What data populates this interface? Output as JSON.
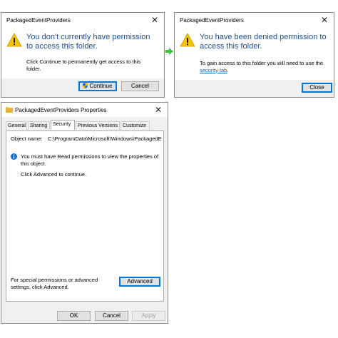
{
  "dialog1": {
    "title": "PackagedEventProviders",
    "message": "You don't currently have permission to access this folder.",
    "detail": "Click Continue to permanently get access to this folder.",
    "continue_label": "Continue",
    "cancel_label": "Cancel"
  },
  "dialog2": {
    "title": "PackagedEventProviders",
    "message": "You have been denied permission to access this folder.",
    "detail_prefix": "To gain access to this folder you will need to use the",
    "detail_link": "security tab",
    "detail_suffix": ".",
    "close_label": "Close"
  },
  "properties": {
    "title": "PackagedEventProviders Properties",
    "tabs": [
      "General",
      "Sharing",
      "Security",
      "Previous Versions",
      "Customize"
    ],
    "active_tab": "Security",
    "object_name_label": "Object name:",
    "object_name_value": "C:\\ProgramData\\Microsoft\\Windows\\PackagedEv",
    "info_text": "You must have Read permissions to view the properties of this object.",
    "advanced_hint": "Click Advanced to continue.",
    "special_text": "For special permissions or advanced settings, click Advanced.",
    "advanced_label": "Advanced",
    "ok_label": "OK",
    "cancel_label": "Cancel",
    "apply_label": "Apply"
  },
  "colors": {
    "message_blue": "#1f4e8c",
    "arrow_green": "#3cc23c",
    "warning_yellow": "#f5c400",
    "focus_blue": "#0078d7",
    "info_blue": "#1f6fd1"
  }
}
